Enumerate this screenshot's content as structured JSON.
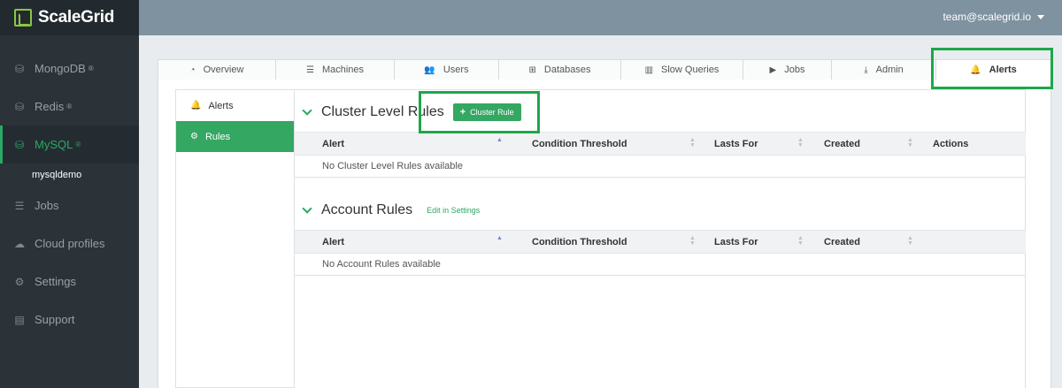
{
  "app": {
    "logo_text": "ScaleGrid",
    "user_email": "team@scalegrid.io"
  },
  "sidebar": {
    "items": [
      {
        "label": "MongoDB",
        "sup": "®",
        "icon": "database-icon"
      },
      {
        "label": "Redis",
        "sup": "®",
        "icon": "database-icon"
      },
      {
        "label": "MySQL",
        "sup": "®",
        "icon": "database-icon",
        "active": true
      },
      {
        "label": "Jobs",
        "icon": "list-icon"
      },
      {
        "label": "Cloud profiles",
        "icon": "cloud-icon"
      },
      {
        "label": "Settings",
        "icon": "cogs-icon"
      },
      {
        "label": "Support",
        "icon": "book-icon"
      }
    ],
    "sub_item": "mysqldemo"
  },
  "tabs": [
    {
      "label": "Overview",
      "icon": "dashboard-icon"
    },
    {
      "label": "Machines",
      "icon": "server-icon"
    },
    {
      "label": "Users",
      "icon": "users-icon"
    },
    {
      "label": "Databases",
      "icon": "sitemap-icon"
    },
    {
      "label": "Slow Queries",
      "icon": "bar-chart-icon"
    },
    {
      "label": "Jobs",
      "icon": "play-icon"
    },
    {
      "label": "Admin",
      "icon": "download-icon"
    },
    {
      "label": "Alerts",
      "icon": "bell-icon",
      "active": true
    }
  ],
  "subnav": {
    "alerts_label": "Alerts",
    "rules_label": "Rules"
  },
  "cluster_rules": {
    "title": "Cluster Level Rules",
    "button_label": "Cluster Rule",
    "columns": [
      "Alert",
      "Condition Threshold",
      "Lasts For",
      "Created",
      "Actions"
    ],
    "empty_text": "No Cluster Level Rules available"
  },
  "account_rules": {
    "title": "Account Rules",
    "link_label": "Edit in Settings",
    "columns": [
      "Alert",
      "Condition Threshold",
      "Lasts For",
      "Created"
    ],
    "empty_text": "No Account Rules available"
  },
  "colors": {
    "accent": "#34a762",
    "sidebar_bg": "#2c3338",
    "topbar_bg": "#7f929f",
    "highlight": "#1fa64a"
  }
}
